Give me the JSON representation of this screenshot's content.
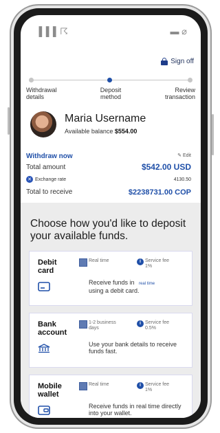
{
  "status_bar": {
    "left": "▐▐▐ ☈",
    "right": "▬ ⌀"
  },
  "header": {
    "signoff_label": "Sign off"
  },
  "stepper": {
    "steps": [
      {
        "label": "Withdrawal details"
      },
      {
        "label": "Deposit method"
      },
      {
        "label": "Review transaction"
      }
    ]
  },
  "user": {
    "name": "Maria Username",
    "balance_prefix": "Available balance",
    "balance_value": "$554.00"
  },
  "summary": {
    "withdraw_now": "Withdraw now",
    "edit": "Edit",
    "total_amount_label": "Total amount",
    "total_amount_value": "$542.00 USD",
    "exchange_rate_label": "Exchange rate",
    "exchange_rate_value": "4130.50",
    "total_to_receive_label": "Total to receive",
    "total_to_receive_value": "$2238731.00 COP"
  },
  "deposit": {
    "heading": "Choose how you'd like to deposit your available funds.",
    "cards": [
      {
        "title": "Debit card",
        "feature1": "Real time",
        "feature2": "Service fee 1%",
        "desc": "Receive funds in using a debit card.",
        "desc_tag": "real time",
        "icon": "card-icon"
      },
      {
        "title": "Bank account",
        "feature1": "1-2 business days",
        "feature2": "Service fee 0.5%",
        "desc": "Use your bank details to receive funds fast.",
        "icon": "bank-icon"
      },
      {
        "title": "Mobile wallet",
        "feature1": "Real time",
        "feature2": "Service fee 1%",
        "desc": "Receive funds in real time directly into your wallet.",
        "icon": "wallet-icon"
      }
    ]
  }
}
